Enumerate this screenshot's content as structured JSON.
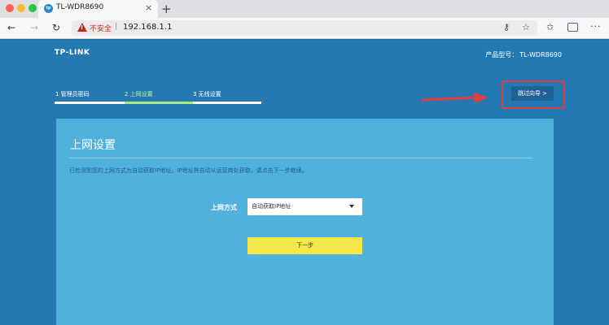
{
  "browser": {
    "tab_title": "TL-WDR8690",
    "tab_close": "×",
    "new_tab": "+",
    "back": "←",
    "forward": "→",
    "reload": "↻",
    "insecure_label": "不安全",
    "url_separator": "|",
    "url": "192.168.1.1",
    "icons": [
      "key-icon",
      "star-icon",
      "favorites-icon",
      "profile-icon",
      "menu-icon"
    ]
  },
  "router": {
    "brand": "TP-LINK",
    "model_label": "产品型号：",
    "model_value": "TL-WDR8690",
    "steps": [
      {
        "label": "1 管理员密码"
      },
      {
        "label": "2 上网设置",
        "active": true
      },
      {
        "label": "3 无线设置"
      }
    ],
    "skip_label": "跳过向导 >",
    "card": {
      "title": "上网设置",
      "description": "已检测到您的上网方式为自动获取IP地址，IP地址将自动从运营商处获取，请点击下一步继续。",
      "field_label": "上网方式",
      "selected_value": "自动获取IP地址",
      "next_label": "下一步"
    }
  },
  "colors": {
    "page_background": "#2579b3",
    "card_background": "#4eb2dc",
    "active_step": "#a9ec7f",
    "next_button": "#f5e74a",
    "highlight": "#e63b3b"
  }
}
